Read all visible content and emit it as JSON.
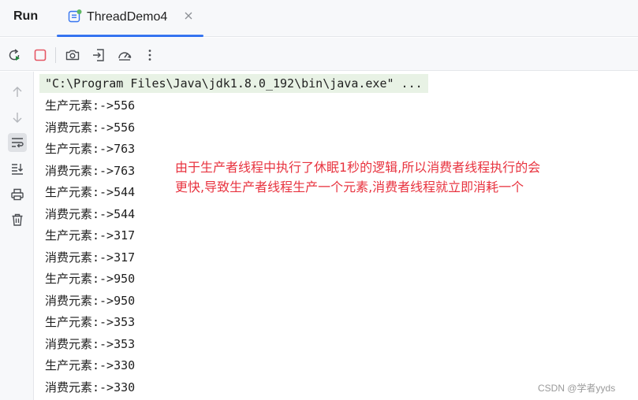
{
  "titlebar": {
    "run_label": "Run",
    "tab": {
      "label": "ThreadDemo4",
      "icon": "java-class-icon",
      "close_icon": "close-icon"
    }
  },
  "toolbar": {
    "icons": [
      "rerun-icon",
      "stop-icon",
      "camera-icon",
      "exit-icon",
      "gauge-icon",
      "more-vertical-icon"
    ]
  },
  "sidebar": {
    "icons": [
      "arrow-up-icon",
      "arrow-down-icon",
      "soft-wrap-icon",
      "scroll-to-end-icon",
      "print-icon",
      "trash-icon"
    ],
    "active_index": 2
  },
  "console": {
    "command": "\"C:\\Program Files\\Java\\jdk1.8.0_192\\bin\\java.exe\" ...",
    "lines": [
      "生产元素:->556",
      "消费元素:->556",
      "生产元素:->763",
      "消费元素:->763",
      "生产元素:->544",
      "消费元素:->544",
      "生产元素:->317",
      "消费元素:->317",
      "生产元素:->950",
      "消费元素:->950",
      "生产元素:->353",
      "消费元素:->353",
      "生产元素:->330",
      "消费元素:->330"
    ]
  },
  "annotation": {
    "line1": "由于生产者线程中执行了休眠1秒的逻辑,所以消费者线程执行的会",
    "line2": "更快,导致生产者线程生产一个元素,消费者线程就立即消耗一个",
    "color": "#e8333f"
  },
  "watermark": "CSDN @学者yyds",
  "colors": {
    "accent": "#3574f0",
    "stop": "#e55765",
    "rerun": "#208a3c",
    "command_bg": "#e8f2e5"
  }
}
